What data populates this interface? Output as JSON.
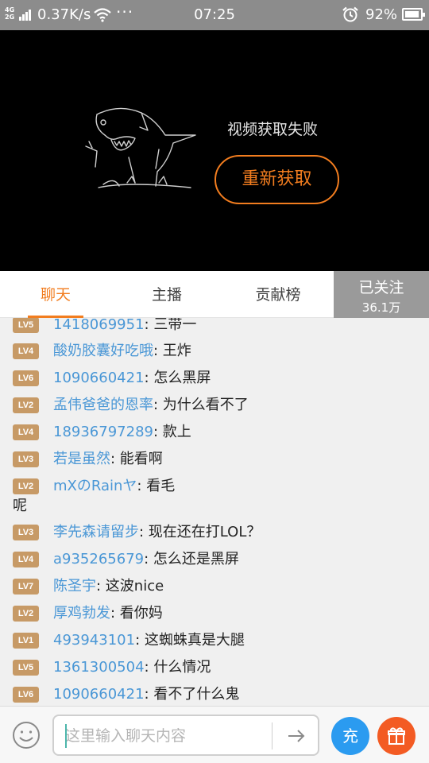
{
  "status_bar": {
    "network_top": "4G",
    "network_bottom": "2G",
    "speed": "0.37K/s",
    "dots": "···",
    "time": "07:25",
    "battery_pct": "92%"
  },
  "video": {
    "fail_message": "视频获取失败",
    "retry_label": "重新获取"
  },
  "tabs": [
    {
      "label": "聊天",
      "active": true
    },
    {
      "label": "主播",
      "active": false
    },
    {
      "label": "贡献榜",
      "active": false
    }
  ],
  "follow": {
    "label": "已关注",
    "count": "36.1万"
  },
  "chat": {
    "partial": {
      "level": "LV5",
      "user": "1418069951",
      "text": ": 三带一"
    },
    "messages": [
      {
        "level": "LV4",
        "user": "酸奶胶囊好吃哦",
        "text": ": 王炸"
      },
      {
        "level": "LV6",
        "user": "1090660421",
        "text": ": 怎么黑屏"
      },
      {
        "level": "LV2",
        "user": "孟伟爸爸的恩率",
        "text": ": 为什么看不了"
      },
      {
        "level": "LV4",
        "user": "18936797289",
        "text": ": 款上"
      },
      {
        "level": "LV3",
        "user": "若是虽然",
        "text": ": 能看啊"
      },
      {
        "level": "LV2",
        "user": "mXのRainヤ",
        "text": ": 看毛",
        "text_line2": "呢"
      },
      {
        "level": "LV3",
        "user": "李先森请留步",
        "text": ": 现在还在打LOL？"
      },
      {
        "level": "LV4",
        "user": "a935265679",
        "text": ": 怎么还是黑屏"
      },
      {
        "level": "LV7",
        "user": "陈圣宇",
        "text": ": 这波nice"
      },
      {
        "level": "LV2",
        "user": "厚鸡勃发",
        "text": ": 看你妈"
      },
      {
        "level": "LV1",
        "user": "493943101",
        "text": ": 这蜘蛛真是大腿"
      },
      {
        "level": "LV5",
        "user": "1361300504",
        "text": ": 什么情况"
      },
      {
        "level": "LV6",
        "user": "1090660421",
        "text": ": 看不了什么鬼"
      }
    ]
  },
  "input_bar": {
    "placeholder": "这里输入聊天内容",
    "recharge_label": "充"
  },
  "colors": {
    "accent": "#f27d1f",
    "username": "#4a97d6",
    "level_badge": "#c79a66",
    "recharge": "#2b9bf0",
    "gift": "#f35b23"
  }
}
